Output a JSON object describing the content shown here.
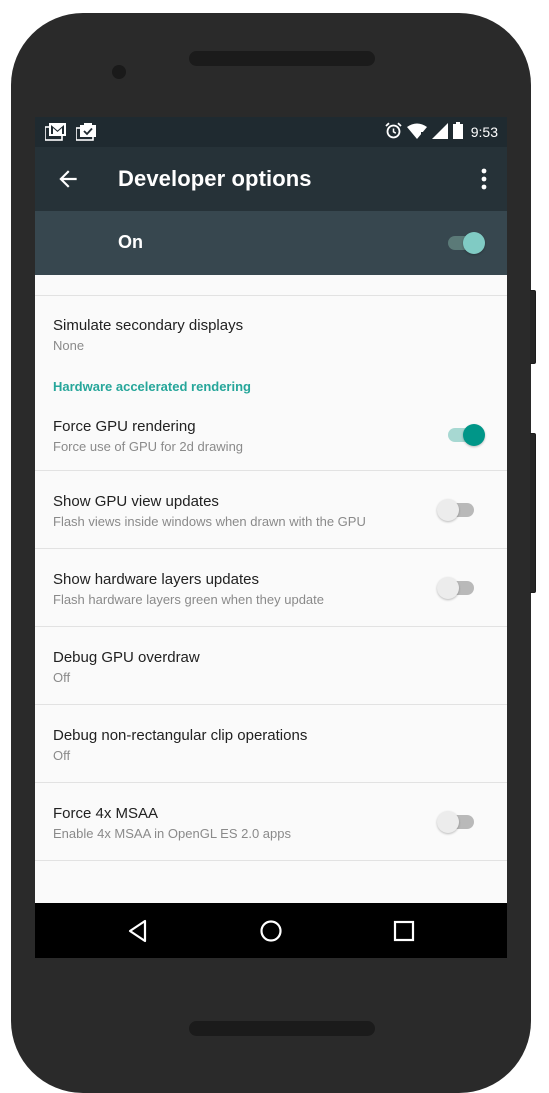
{
  "status_bar": {
    "left_icons": [
      "gmail-notification-icon",
      "tasks-notification-icon"
    ],
    "right_icons": [
      "alarm-icon",
      "wifi-icon",
      "cell-signal-icon",
      "battery-icon"
    ],
    "time": "9:53"
  },
  "app_bar": {
    "back_icon": "arrow-back-icon",
    "title": "Developer options",
    "overflow_icon": "more-vert-icon"
  },
  "master_switch": {
    "label": "On",
    "checked": true
  },
  "settings": [
    {
      "title": "Simulate secondary displays",
      "summary": "None",
      "toggle": null
    },
    {
      "section_header": "Hardware accelerated rendering"
    },
    {
      "title": "Force GPU rendering",
      "summary": "Force use of GPU for 2d drawing",
      "toggle": true
    },
    {
      "title": "Show GPU view updates",
      "summary": "Flash views inside windows when drawn with the GPU",
      "toggle": false
    },
    {
      "title": "Show hardware layers updates",
      "summary": "Flash hardware layers green when they update",
      "toggle": false
    },
    {
      "title": "Debug GPU overdraw",
      "summary": "Off",
      "toggle": null
    },
    {
      "title": "Debug non-rectangular clip operations",
      "summary": "Off",
      "toggle": null
    },
    {
      "title": "Force 4x MSAA",
      "summary": "Enable 4x MSAA in OpenGL ES 2.0 apps",
      "toggle": false
    }
  ],
  "nav_bar": {
    "buttons": [
      "back-nav-icon",
      "home-nav-icon",
      "recents-nav-icon"
    ]
  },
  "colors": {
    "accent": "#26a69a",
    "toggle_on_thumb": "#009688",
    "toggle_on_track": "#a7d8d2",
    "master_thumb": "#80cbc4",
    "master_track": "#5b7a78",
    "toggle_off_thumb": "#ececec",
    "toggle_off_track": "#b9b9b9",
    "app_bar": "#263238",
    "master_bar": "#37474f"
  }
}
